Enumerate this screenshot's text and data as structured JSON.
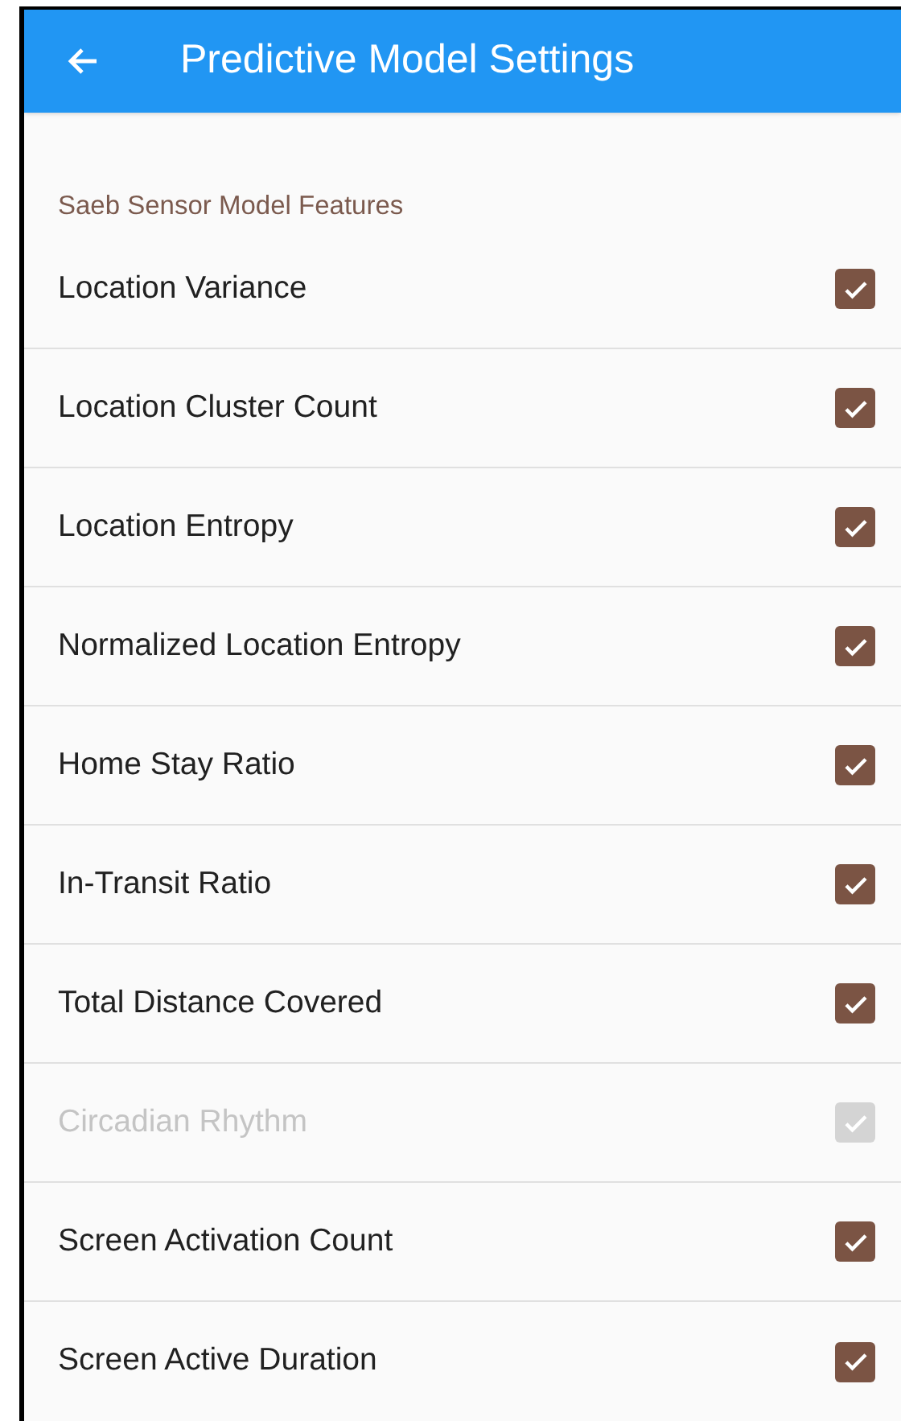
{
  "app_bar": {
    "title": "Predictive Model Settings"
  },
  "section": {
    "title": "Saeb Sensor Model Features"
  },
  "features": [
    {
      "label": "Location Variance",
      "checked": true,
      "disabled": false
    },
    {
      "label": "Location Cluster Count",
      "checked": true,
      "disabled": false
    },
    {
      "label": "Location Entropy",
      "checked": true,
      "disabled": false
    },
    {
      "label": "Normalized Location Entropy",
      "checked": true,
      "disabled": false
    },
    {
      "label": "Home Stay Ratio",
      "checked": true,
      "disabled": false
    },
    {
      "label": "In-Transit Ratio",
      "checked": true,
      "disabled": false
    },
    {
      "label": "Total Distance Covered",
      "checked": true,
      "disabled": false
    },
    {
      "label": "Circadian Rhythm",
      "checked": true,
      "disabled": true
    },
    {
      "label": "Screen Activation Count",
      "checked": true,
      "disabled": false
    },
    {
      "label": "Screen Active Duration",
      "checked": true,
      "disabled": false
    }
  ]
}
